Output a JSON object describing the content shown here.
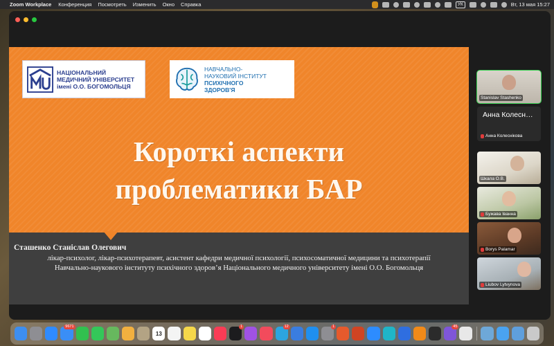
{
  "menubar": {
    "app_name": "Zoom Workplace",
    "menus": [
      "Конференция",
      "Посмотреть",
      "Изменить",
      "Окно",
      "Справка"
    ],
    "keyboard_layout": "УК",
    "datetime": "Вт, 13 мая  15:27"
  },
  "slide": {
    "logo_left_lines": [
      "НАЦІОНАЛЬНИЙ",
      "МЕДИЧНИЙ УНІВЕРСИТЕТ",
      "імені О.О. БОГОМОЛЬЦЯ"
    ],
    "logo_right_lines": [
      "НАВЧАЛЬНО-",
      "НАУКОВИЙ ІНСТИТУТ"
    ],
    "logo_right_bold_lines": [
      "ПСИХІЧНОГО",
      "ЗДОРОВ'Я"
    ],
    "title_line1": "Короткі аспекти",
    "title_line2": "проблематики БАР",
    "presenter_name": "Сташенко Станіслав Олегович",
    "presenter_desc_line1": "лікар-психолог, лікар-психотерапевт, асистент кафедри медичної психології, психосоматичної медицини та психотерапії",
    "presenter_desc_line2": "Навчально-наукового інституту психічного здоров’я Національного медичного університету імені О.О. Богомольця",
    "colors": {
      "orange": "#f0852a",
      "dark": "#3f3f3f",
      "brand_blue": "#2c3f8f"
    }
  },
  "participants": {
    "speaker": "Stanislav Stashenko",
    "name_only_big": "Анна Колесн…",
    "name_only_label": "Анна Колеснікова",
    "tiles": [
      "Шкала О.В.",
      "Бужава Іванна",
      "Borys Palamar",
      "Liubov Lytvynova"
    ]
  },
  "dock": {
    "apps": [
      {
        "name": "finder-icon",
        "color": "#3d8ef0"
      },
      {
        "name": "launchpad-icon",
        "color": "#8e8e93"
      },
      {
        "name": "safari-icon",
        "color": "#2f8bff"
      },
      {
        "name": "mail-icon",
        "color": "#3a8ef6",
        "badge": "9671"
      },
      {
        "name": "facetime-icon",
        "color": "#31c04f"
      },
      {
        "name": "messages-icon",
        "color": "#34c759"
      },
      {
        "name": "maps-icon",
        "color": "#67b85e"
      },
      {
        "name": "photos-icon",
        "color": "#f2b03f"
      },
      {
        "name": "contacts-icon",
        "color": "#b3a384"
      },
      {
        "name": "calendar-icon",
        "color": "#ffffff",
        "text": "13"
      },
      {
        "name": "reminders-icon",
        "color": "#f4f4f4"
      },
      {
        "name": "notes-icon",
        "color": "#f6d84a"
      },
      {
        "name": "freeform-icon",
        "color": "#ffffff"
      },
      {
        "name": "music-icon",
        "color": "#fa3c55"
      },
      {
        "name": "tv-icon",
        "color": "#1c1c1e",
        "badge": "1"
      },
      {
        "name": "podcasts-icon",
        "color": "#a052e3"
      },
      {
        "name": "news-icon",
        "color": "#f24b5c"
      },
      {
        "name": "telegram-icon",
        "color": "#2ca5e0",
        "badge": "12"
      },
      {
        "name": "files-icon",
        "color": "#3a7de0"
      },
      {
        "name": "appstore-icon",
        "color": "#1f8ff0"
      },
      {
        "name": "settings-icon",
        "color": "#8e8e93",
        "badge": "1"
      },
      {
        "name": "office-icon",
        "color": "#e65a2c"
      },
      {
        "name": "powerpoint-icon",
        "color": "#d04423"
      },
      {
        "name": "zoom-icon",
        "color": "#2d8cff"
      },
      {
        "name": "canva-icon",
        "color": "#1fb5c8"
      },
      {
        "name": "cloud-icon",
        "color": "#2f6ee0"
      },
      {
        "name": "vlc-icon",
        "color": "#f18a19"
      },
      {
        "name": "terminal-icon",
        "color": "#2b2b2b"
      },
      {
        "name": "viber-icon",
        "color": "#7f56d9",
        "badge": "45"
      },
      {
        "name": "chrome-icon",
        "color": "#e8e8e8"
      },
      {
        "name": "preview-icon",
        "color": "#6ea8d8"
      },
      {
        "name": "folder-icon",
        "color": "#4aa3f0"
      },
      {
        "name": "downloads-icon",
        "color": "#5f9fdc"
      },
      {
        "name": "trash-icon",
        "color": "#c9c9c9"
      }
    ]
  }
}
